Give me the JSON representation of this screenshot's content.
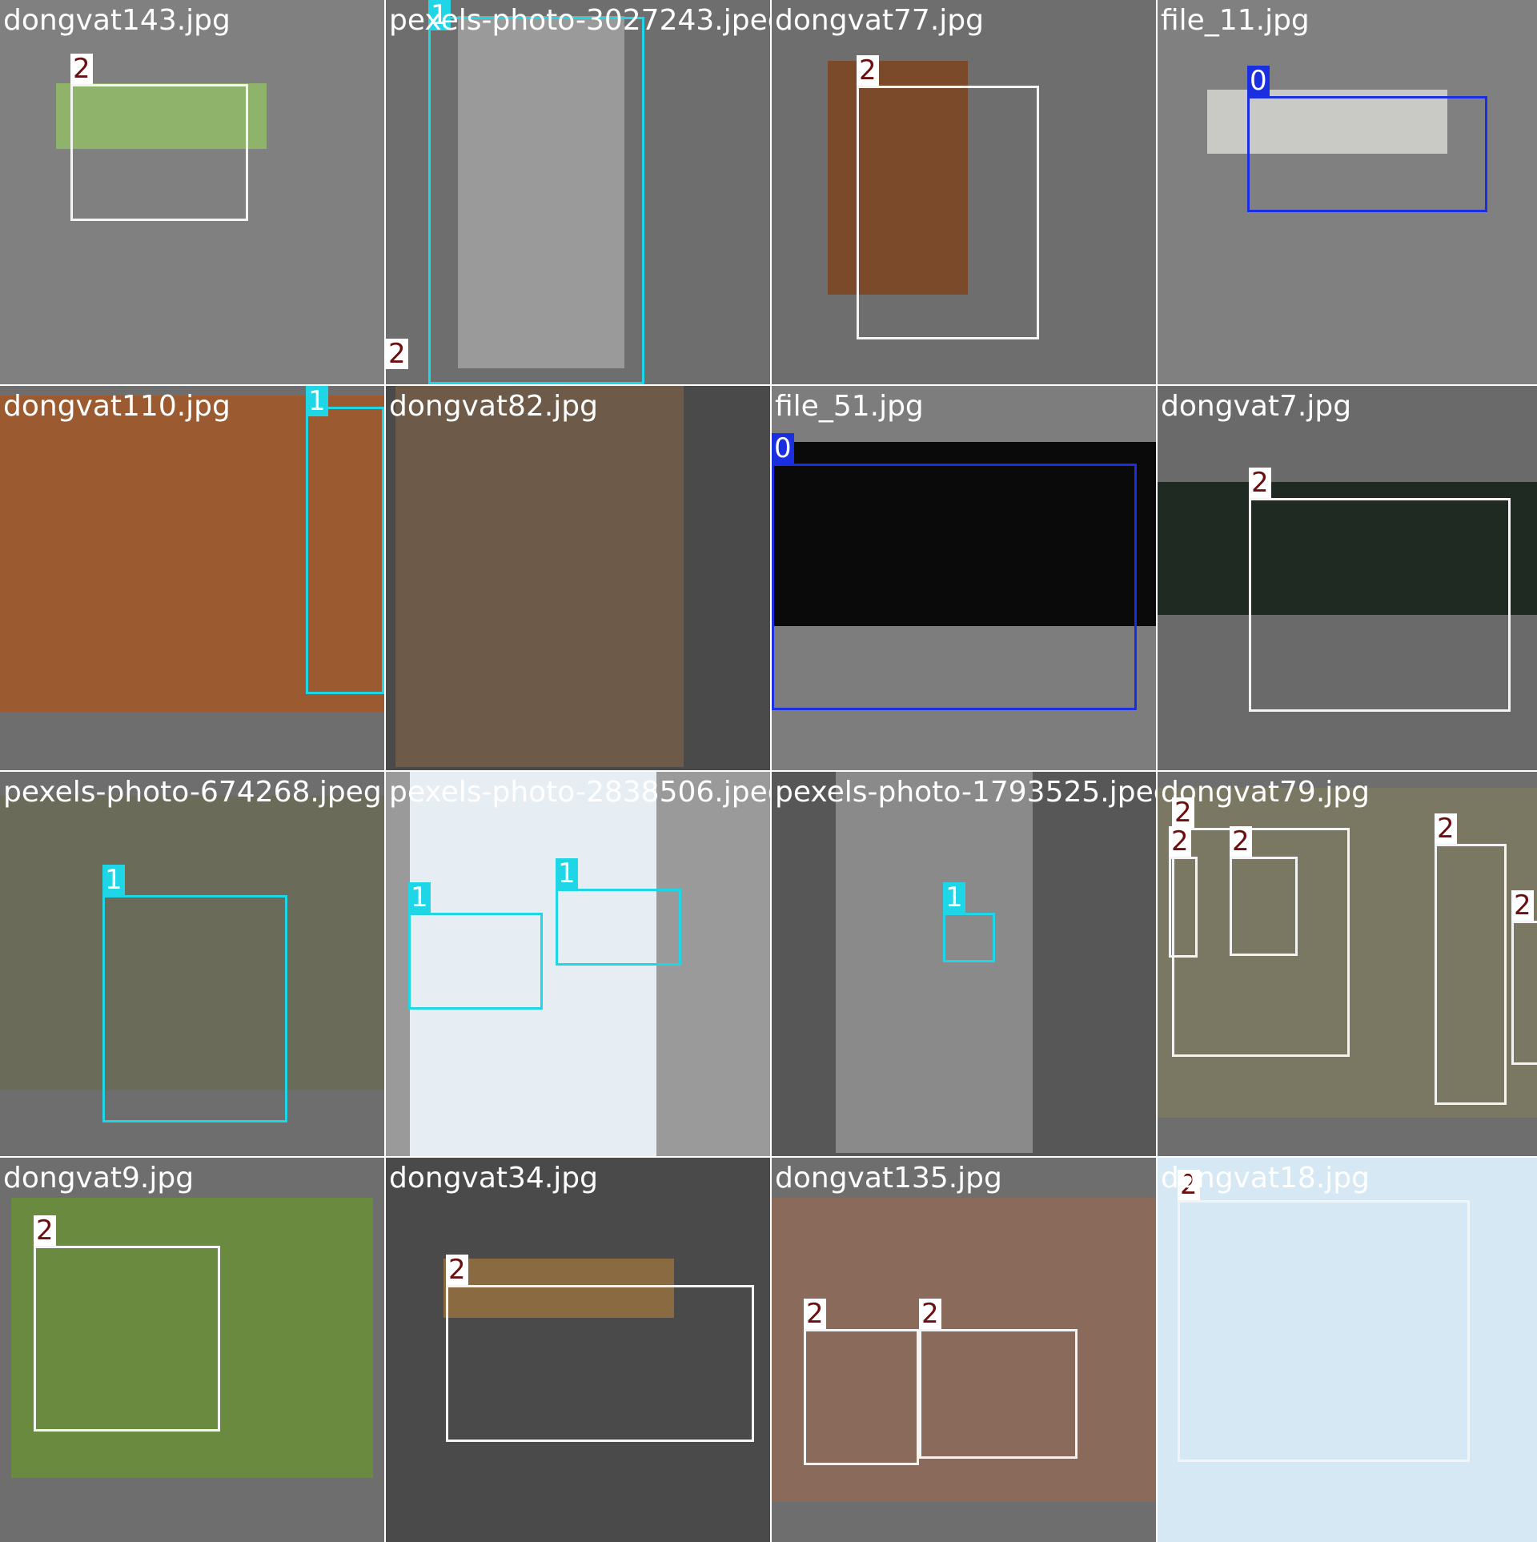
{
  "colors": {
    "class_0": {
      "box": "#1a2fe0",
      "tag_bg": "#1a2fe0",
      "tag_fg": "#ffffff"
    },
    "class_1": {
      "box": "#1ed6e6",
      "tag_bg": "#1ed6e6",
      "tag_fg": "#ffffff"
    },
    "class_2": {
      "box": "#f4f4f4",
      "tag_bg": "#ffffff",
      "tag_fg": "#6b1010"
    }
  },
  "tiles": [
    {
      "filename": "dongvat143.jpg",
      "bg": "#808080",
      "photo": "cow-face",
      "photo_color": "#8fb36a",
      "labels": [
        {
          "cls": "2"
        }
      ]
    },
    {
      "filename": "pexels-photo-3027243.jpeg",
      "bg": "#6e6e6e",
      "photo": "man-in-hat",
      "photo_color": "#9a9a9a",
      "labels": [
        {
          "cls": "1"
        },
        {
          "cls": "2"
        }
      ]
    },
    {
      "filename": "dongvat77.jpg",
      "bg": "#6e6e6e",
      "photo": "rooster",
      "photo_color": "#7a4a2a",
      "labels": [
        {
          "cls": "2"
        }
      ]
    },
    {
      "filename": "file_11.jpg",
      "bg": "#808080",
      "photo": "banded-snake",
      "photo_color": "#c9c9c5",
      "labels": [
        {
          "cls": "0"
        }
      ]
    },
    {
      "filename": "dongvat110.jpg",
      "bg": "#6e6e6e",
      "photo": "cattle-barn",
      "photo_color": "#9c5a30",
      "labels": [
        {
          "cls": "1"
        }
      ]
    },
    {
      "filename": "dongvat82.jpg",
      "bg": "#4a4a4a",
      "photo": "black-duck",
      "photo_color": "#6e5a48",
      "labels": []
    },
    {
      "filename": "file_51.jpg",
      "bg": "#7d7d7d",
      "photo": "viper",
      "photo_color": "#0a0a0a",
      "labels": [
        {
          "cls": "0"
        }
      ]
    },
    {
      "filename": "dongvat7.jpg",
      "bg": "#6a6a6a",
      "photo": "white-chicken",
      "photo_color": "#1f2a22",
      "labels": [
        {
          "cls": "2"
        }
      ]
    },
    {
      "filename": "pexels-photo-674268.jpeg",
      "bg": "#6e6e6e",
      "photo": "woman-forest",
      "photo_color": "#6a6b58",
      "labels": [
        {
          "cls": "1"
        }
      ]
    },
    {
      "filename": "pexels-photo-2838506.jpeg",
      "bg": "#9a9a9a",
      "photo": "reaching-hands",
      "photo_color": "#e6eef4",
      "labels": [
        {
          "cls": "1"
        },
        {
          "cls": "1"
        }
      ]
    },
    {
      "filename": "pexels-photo-1793525.jpeg",
      "bg": "#575757",
      "photo": "foggy-mountain",
      "photo_color": "#8a8a8a",
      "labels": [
        {
          "cls": "1"
        }
      ]
    },
    {
      "filename": "dongvat79.jpg",
      "bg": "#6e6e6e",
      "photo": "chicken-flock",
      "photo_color": "#7a7862",
      "labels": [
        {
          "cls": "2"
        },
        {
          "cls": "2"
        },
        {
          "cls": "2"
        },
        {
          "cls": "2"
        },
        {
          "cls": "2"
        }
      ]
    },
    {
      "filename": "dongvat9.jpg",
      "bg": "#6e6e6e",
      "photo": "hen-in-grass",
      "photo_color": "#6a8a3f",
      "labels": [
        {
          "cls": "2"
        }
      ]
    },
    {
      "filename": "dongvat34.jpg",
      "bg": "#4a4a4a",
      "photo": "brown-bull",
      "photo_color": "#8a6a40",
      "labels": [
        {
          "cls": "2"
        }
      ]
    },
    {
      "filename": "dongvat135.jpg",
      "bg": "#6e6e6e",
      "photo": "quails",
      "photo_color": "#8a6a5a",
      "labels": [
        {
          "cls": "2"
        },
        {
          "cls": "2"
        }
      ]
    },
    {
      "filename": "dongvat18.jpg",
      "bg": "#cfe4f2",
      "photo": "flying-hen",
      "photo_color": "#d6e8f4",
      "labels": [
        {
          "cls": "2"
        }
      ]
    }
  ]
}
